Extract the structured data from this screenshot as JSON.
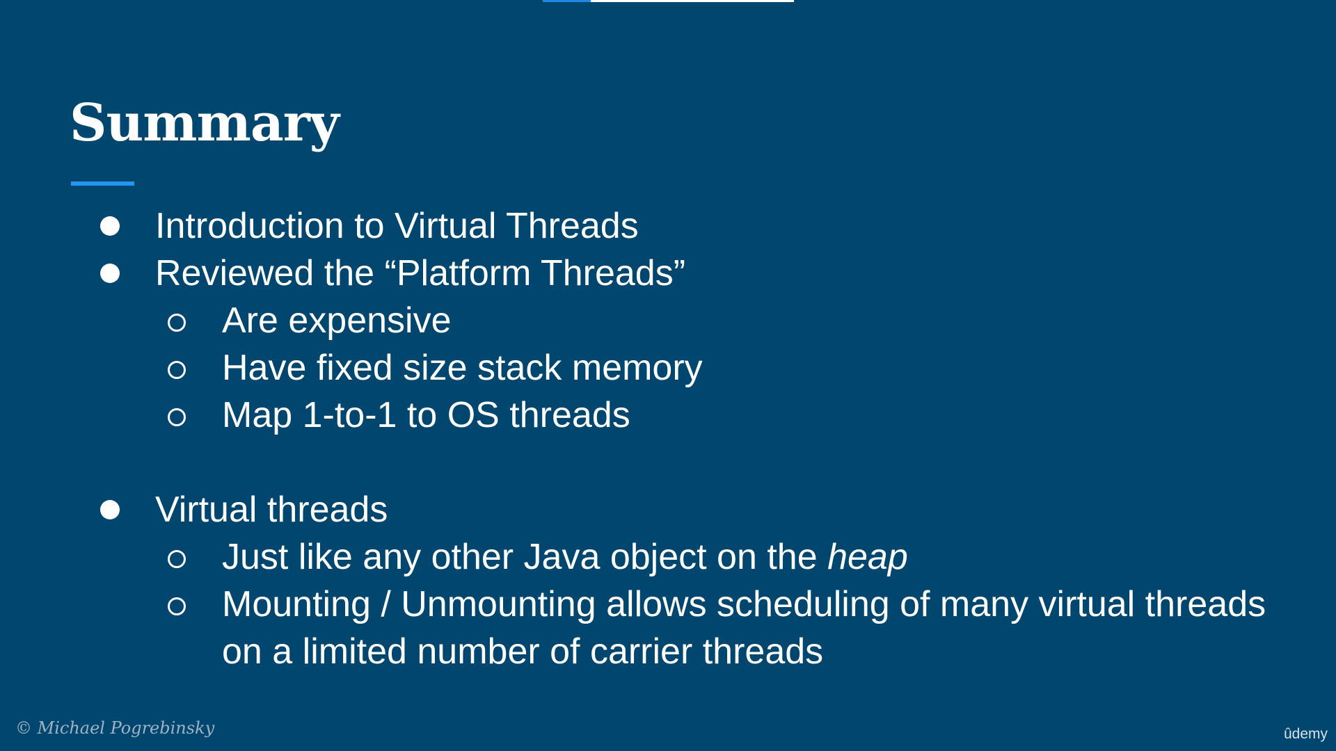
{
  "slide": {
    "title": "Summary",
    "bullets": [
      {
        "level": 1,
        "text": "Introduction to Virtual Threads"
      },
      {
        "level": 1,
        "text": "Reviewed the “Platform Threads”"
      },
      {
        "level": 2,
        "text": "Are expensive"
      },
      {
        "level": 2,
        "text": "Have fixed size stack memory"
      },
      {
        "level": 2,
        "text": "Map 1-to-1 to OS threads"
      },
      {
        "level": 1,
        "text": "Virtual threads"
      },
      {
        "level": 2,
        "text_before": "Just like any other Java object on the ",
        "text_emphasis": "heap"
      },
      {
        "level": 2,
        "text": "Mounting / Unmounting allows scheduling of many virtual threads on a limited number of carrier threads"
      }
    ],
    "copyright": "© Michael Pogrebinsky"
  },
  "player": {
    "brand": "ûdemy",
    "progress_fraction": 0.19
  },
  "colors": {
    "background": "#01466e",
    "accent": "#2196f3",
    "text": "#ffffff"
  }
}
